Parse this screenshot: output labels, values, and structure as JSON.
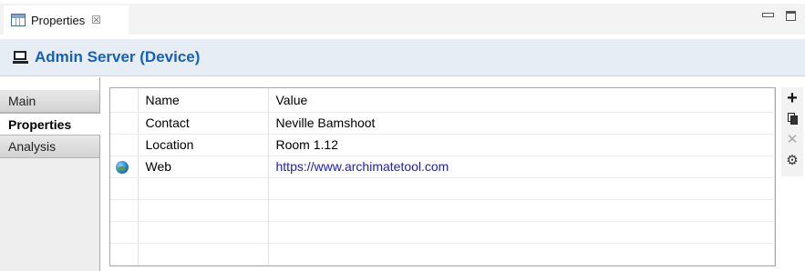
{
  "view": {
    "tab_label": "Properties",
    "tab_close": "☒",
    "tab_icon": "table-icon"
  },
  "header": {
    "icon": "device-icon",
    "title": "Admin Server (Device)"
  },
  "left_tabs": [
    {
      "label": "Main",
      "active": false
    },
    {
      "label": "Properties",
      "active": true
    },
    {
      "label": "Analysis",
      "active": false
    }
  ],
  "table": {
    "columns": {
      "name": "Name",
      "value": "Value"
    },
    "rows": [
      {
        "name": "Contact",
        "value": "Neville Bamshoot",
        "icon": ""
      },
      {
        "name": "Location",
        "value": "Room 1.12",
        "icon": ""
      },
      {
        "name": "Web",
        "value": "https://www.archimatetool.com",
        "icon": "globe-icon"
      }
    ],
    "empty_rows": 4
  },
  "toolbar": {
    "add": "+",
    "copy": "copy-icon",
    "remove": "✕",
    "manage": "⚙"
  },
  "colors": {
    "header_bg": "#e6edf4",
    "title": "#1560bd",
    "link": "#1a1ad0"
  }
}
